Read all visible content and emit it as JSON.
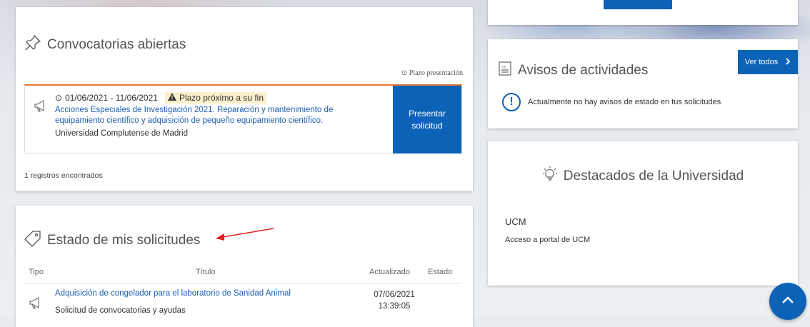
{
  "convocatorias": {
    "title": "Convocatorias abiertas",
    "plazo_header": "Plazo presentación",
    "item": {
      "dates": "01/06/2021 - 11/06/2021",
      "warning": "Plazo próximo a su fin",
      "title_line1": "Acciones Especiales de Investigación 2021. Reparación y mantenimiento de",
      "title_line2": "equipamiento científico y adquisición de pequeño equipamiento científico.",
      "organization": "Universidad Complutense de Madrid",
      "button_line1": "Presentar",
      "button_line2": "solicitud"
    },
    "records": "1 registros encontrados"
  },
  "estado": {
    "title": "Estado de mis solicitudes",
    "columns": [
      "Tipo",
      "Título",
      "Actualizado",
      "Estado"
    ],
    "rows": [
      {
        "title": "Adquisición de congelador para el laboratorio de Sanidad Animal",
        "subtitle": "Solicitud de convocatorias y ayudas",
        "date": "07/06/2021",
        "time": "13:39:05",
        "status": ""
      }
    ]
  },
  "avisos": {
    "title": "Avisos de actividades",
    "button": "Ver todos",
    "message": "Actualmente no hay avisos de estado en tus solicitudes"
  },
  "destacados": {
    "title": "Destacados de la Universidad",
    "item_title": "UCM",
    "item_link": "Acceso a portal de UCM"
  },
  "colors": {
    "primary": "#0b62b6",
    "link": "#1f5fb3",
    "warning_bg": "#fbf0cc",
    "accent_border": "#e8793b",
    "annotation_arrow": "#e02020"
  },
  "icons": [
    "pin-icon",
    "megaphone-icon",
    "clock-icon",
    "warning-icon",
    "tag-icon",
    "document-icon",
    "exclamation-icon",
    "lightbulb-icon",
    "chevron-right-icon",
    "chevron-up-icon"
  ]
}
